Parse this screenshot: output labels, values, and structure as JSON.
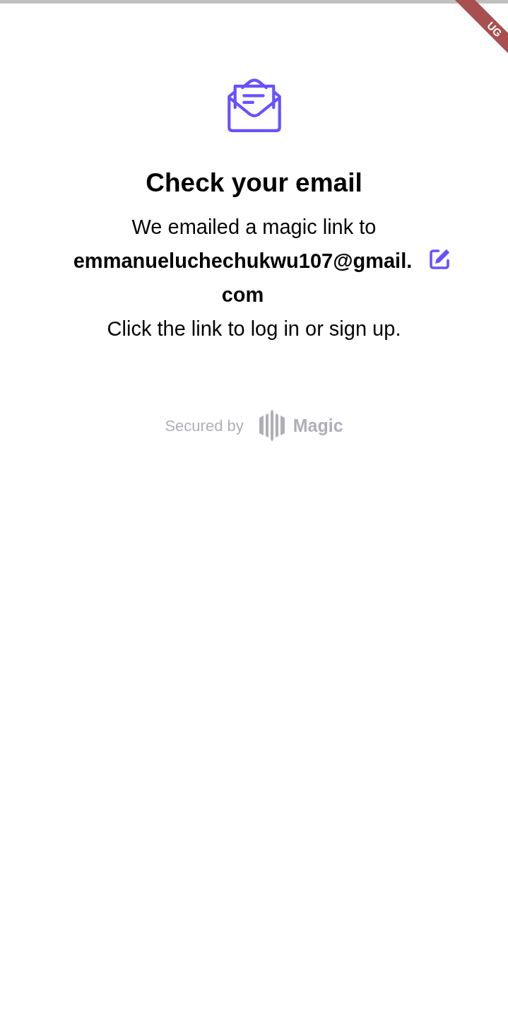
{
  "debug_banner": {
    "label": "UG"
  },
  "title": "Check your email",
  "message": {
    "intro": "We emailed a magic link to",
    "email": "emmanueluchechukwu107@gmail.com",
    "instruction": "Click the link to log in or sign up."
  },
  "footer": {
    "secured_by": "Secured by",
    "brand": "Magic"
  }
}
